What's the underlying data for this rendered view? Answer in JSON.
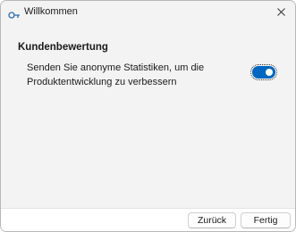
{
  "window": {
    "title": "Willkommen",
    "app_icon": "key-icon",
    "close_icon": "close-icon"
  },
  "section": {
    "heading": "Kundenbewertung",
    "setting_line1": "Senden Sie anonyme Statistiken, um die",
    "setting_line2": "Produktentwicklung zu verbessern",
    "toggle_state": true
  },
  "footer": {
    "back_label": "Zurück",
    "finish_label": "Fertig"
  },
  "colors": {
    "accent": "#0067c0",
    "window_bg": "#f3f3f3",
    "footer_bg": "#ffffff"
  }
}
